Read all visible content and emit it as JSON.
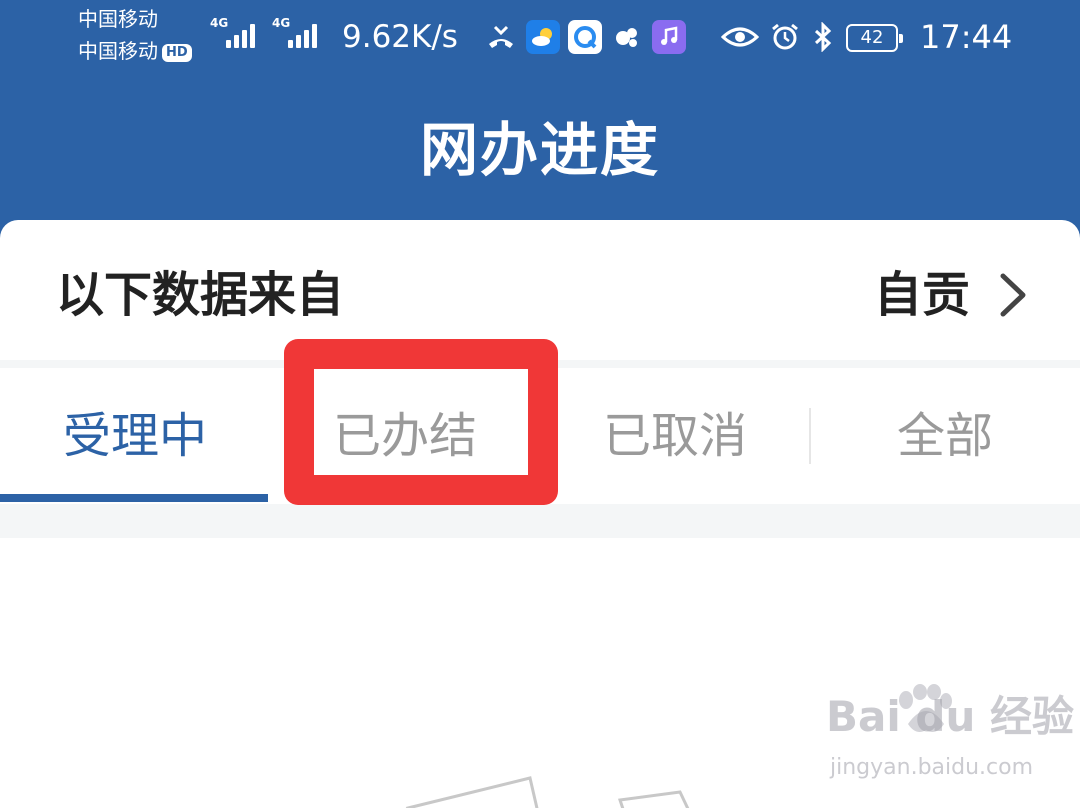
{
  "status_bar": {
    "carrier1": "中国移动",
    "carrier2": "中国移动",
    "hd_badge": "HD",
    "network1": "4G",
    "network2": "4G",
    "speed": "9.62K/s",
    "battery": "42",
    "time": "17:44",
    "icons": [
      "missed-call-icon",
      "weather-app-icon",
      "browser-app-icon",
      "notification-icon",
      "music-app-icon",
      "eye-comfort-icon",
      "alarm-icon",
      "bluetooth-icon"
    ]
  },
  "header": {
    "title": "网办进度"
  },
  "source": {
    "label": "以下数据来自",
    "value": "自贡"
  },
  "tabs": [
    {
      "label": "受理中",
      "active": true
    },
    {
      "label": "已办结",
      "active": false
    },
    {
      "label": "已取消",
      "active": false
    },
    {
      "label": "全部",
      "active": false
    }
  ],
  "watermark": {
    "brand": "Bai du 经验",
    "url": "jingyan.baidu.com"
  },
  "colors": {
    "header_bg": "#2c62a6",
    "active_tab": "#2c62a6",
    "inactive_tab": "#9a9a9a",
    "highlight": "#f03737"
  }
}
